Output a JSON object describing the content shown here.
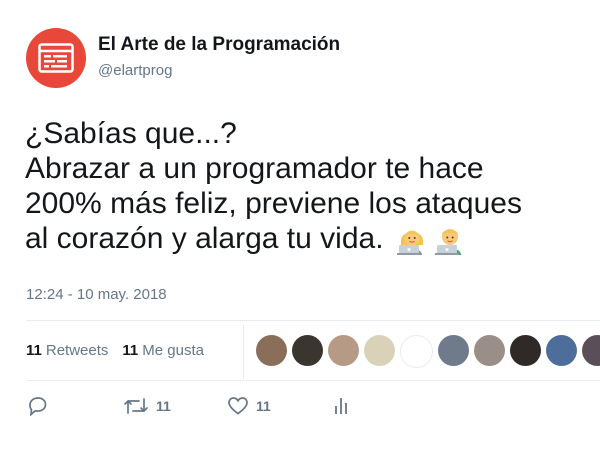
{
  "tweet": {
    "author": {
      "name": "El Arte de la Programación",
      "handle": "@elartprog"
    },
    "text_lines": [
      "¿Sabías que...?",
      "Abrazar a un programador te hace",
      "200% más feliz, previene los ataques",
      "al corazón y alarga tu vida."
    ],
    "emojis": [
      "woman-technologist-emoji",
      "man-technologist-emoji"
    ],
    "timestamp": "12:24 - 10 may. 2018",
    "stats": {
      "retweets_count": "11",
      "retweets_label": "Retweets",
      "likes_count": "11",
      "likes_label": "Me gusta"
    },
    "likers": [
      {
        "name": "liker-avatar-1",
        "color": "#8a6e5a"
      },
      {
        "name": "liker-avatar-2",
        "color": "#3b3530"
      },
      {
        "name": "liker-avatar-3",
        "color": "#b79a86"
      },
      {
        "name": "liker-avatar-4",
        "color": "#d9d2b8"
      },
      {
        "name": "liker-avatar-5",
        "color": "#ffffff"
      },
      {
        "name": "liker-avatar-6",
        "color": "#6f7a8a"
      },
      {
        "name": "liker-avatar-7",
        "color": "#9a8f88"
      },
      {
        "name": "liker-avatar-8",
        "color": "#2f2a28"
      },
      {
        "name": "liker-avatar-9",
        "color": "#4d6e9a"
      },
      {
        "name": "liker-avatar-10",
        "color": "#5a4f58"
      }
    ],
    "actions": {
      "retweet_count": "11",
      "like_count": "11"
    }
  },
  "colors": {
    "brand": "#e8483a",
    "muted": "#657786",
    "text": "#14171a",
    "divider": "#e6ecf0"
  }
}
